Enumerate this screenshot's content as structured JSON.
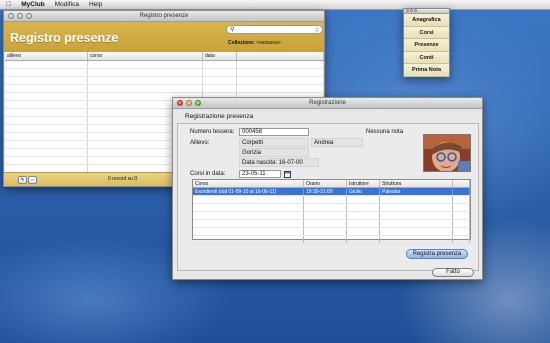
{
  "menubar": {
    "apple": "",
    "items": [
      "MyClub",
      "Modifica",
      "Help"
    ]
  },
  "registro": {
    "window_title": "Registro presenze",
    "title": "Registro presenze",
    "search": {
      "placeholder": "",
      "icon": "magnifier-icon"
    },
    "collezione_label": "Collezione:",
    "collezione_value": "<nessuna>",
    "columns": [
      "allievo",
      "corso",
      "data",
      ""
    ],
    "record_count": "0 record su 0",
    "footer_buttons": [
      "✎",
      "−"
    ],
    "accent_color": "#d1ad45"
  },
  "palette": {
    "items": [
      "Anagrafica",
      "Corsi",
      "Presenze",
      "Conti",
      "Prima Nota"
    ]
  },
  "registrazione": {
    "window_title": "Registrazione",
    "subtitle": "Registrazione presenza",
    "numero_tessera_label": "Numero tessera:",
    "numero_tessera": "000458",
    "allievo_label": "Allievo:",
    "cognome": "Corpetti",
    "nome": "Andrea",
    "citta": "Gorizia",
    "data_nascita": "Data nascita: 16-07-00",
    "nota": "Nessuna nota",
    "corsi_label": "Corsi in data:",
    "corsi_data": "23-05-11",
    "table": {
      "columns": [
        "Corso",
        "Orario",
        "Istruttore",
        "Struttura",
        ""
      ],
      "rows": [
        [
          "Esordienti (dal 01-09-10 al 16-06-11)",
          "19:30-21:00",
          "Giulio",
          "Palestra",
          ""
        ]
      ]
    },
    "registra_button": "Registra presenza",
    "fatto_button": "Fatto",
    "selection_color": "#3875d7"
  }
}
